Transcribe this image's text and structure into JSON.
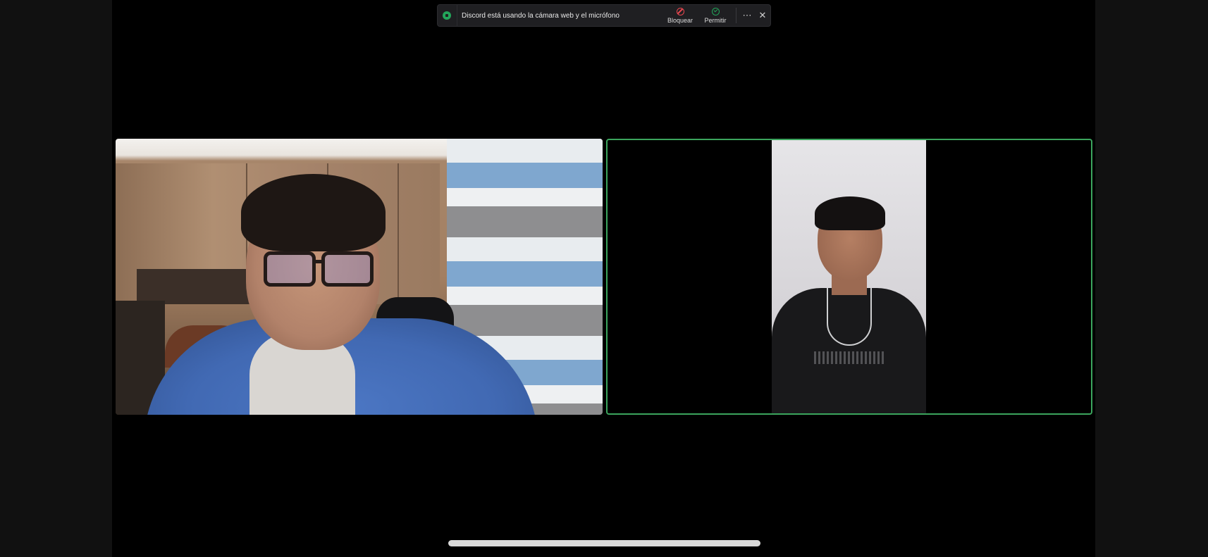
{
  "banner": {
    "text": "Discord está usando la cámara web y el micrófono",
    "block_label": "Bloquear",
    "allow_label": "Permitir",
    "more_icon": "ellipsis-icon",
    "close_icon": "close-icon",
    "status_color": "#23a55a",
    "block_color": "#e8474f"
  },
  "video_grid": {
    "tiles": [
      {
        "name": "local-camera-tile",
        "speaking": false
      },
      {
        "name": "remote-camera-tile",
        "speaking": true,
        "speaking_border_color": "#3ba55d"
      }
    ]
  }
}
